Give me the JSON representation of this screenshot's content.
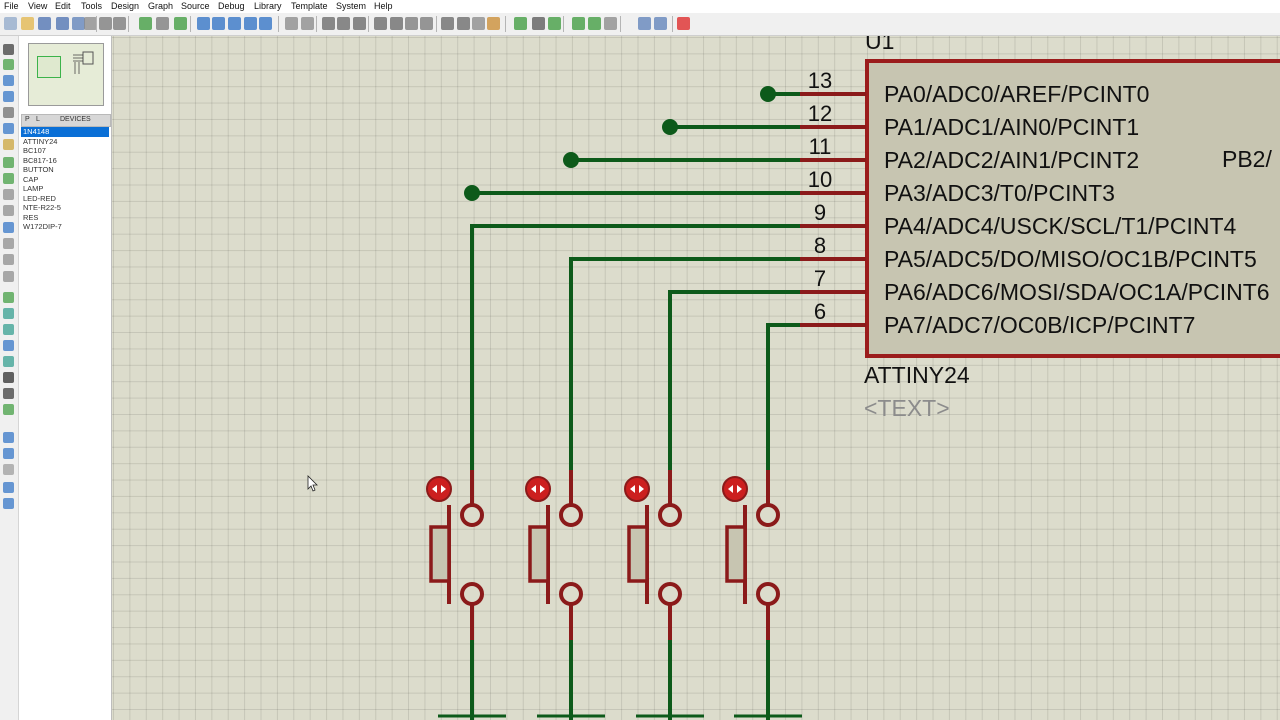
{
  "menu": [
    "File",
    "View",
    "Edit",
    "Tools",
    "Design",
    "Graph",
    "Source",
    "Debug",
    "Library",
    "Template",
    "System",
    "Help"
  ],
  "device_panel": {
    "tab_p": "P",
    "tab_l": "L",
    "title": "DEVICES",
    "devices": [
      "1N4148",
      "ATTINY24",
      "BC107",
      "BC817-16",
      "BUTTON",
      "CAP",
      "LAMP",
      "LED-RED",
      "NTE-R22-5",
      "RES",
      "W172DIP-7"
    ],
    "selected_index": 0
  },
  "schematic": {
    "chip_ref_partial": "U1",
    "chip_part": "ATTINY24",
    "chip_text": "<TEXT>",
    "pins": [
      {
        "num": "13",
        "label": "PA0/ADC0/AREF/PCINT0"
      },
      {
        "num": "12",
        "label": "PA1/ADC1/AIN0/PCINT1"
      },
      {
        "num": "11",
        "label": "PA2/ADC2/AIN1/PCINT2"
      },
      {
        "num": "10",
        "label": "PA3/ADC3/T0/PCINT3"
      },
      {
        "num": "9",
        "label": "PA4/ADC4/USCK/SCL/T1/PCINT4"
      },
      {
        "num": "8",
        "label": "PA5/ADC5/DO/MISO/OC1B/PCINT5"
      },
      {
        "num": "7",
        "label": "PA6/ADC6/MOSI/SDA/OC1A/PCINT6"
      },
      {
        "num": "6",
        "label": "PA7/ADC7/OC0B/ICP/PCINT7"
      }
    ],
    "right_pin_partial": "PB2/",
    "button_count": 4
  },
  "colors": {
    "wire": "#0d5a1a",
    "pin": "#8b1a1a",
    "chip_fill": "#c7c5b1",
    "chip_border": "#9b1c1c",
    "canvas": "#dcdccc"
  }
}
